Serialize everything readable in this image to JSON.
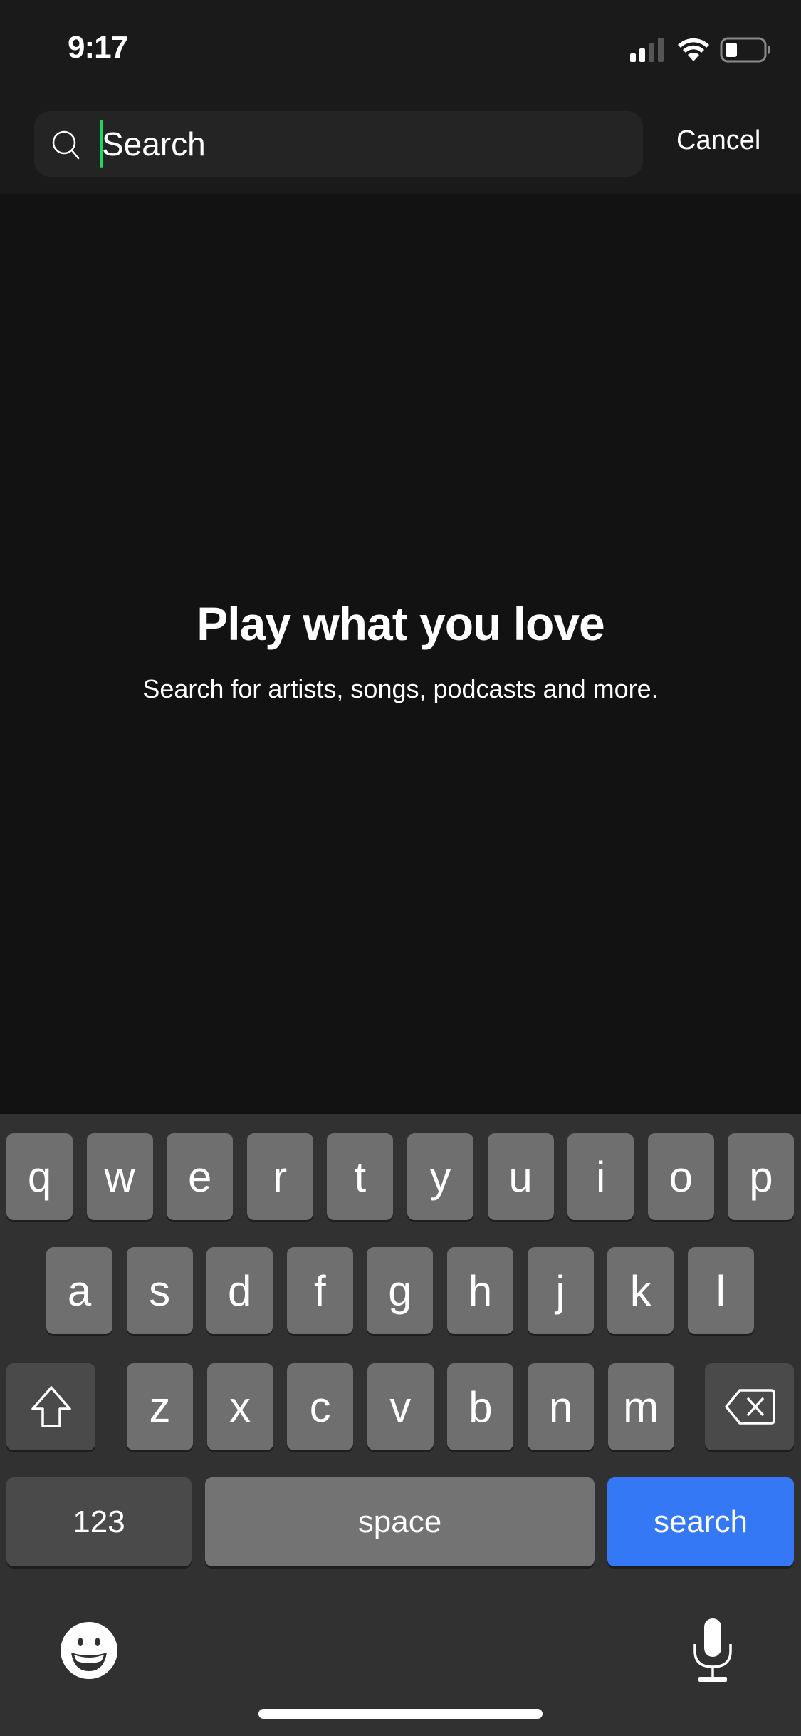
{
  "status_bar": {
    "time": "9:17",
    "icons": [
      "cellular-signal-icon",
      "wifi-icon",
      "battery-icon"
    ]
  },
  "search": {
    "placeholder": "Search",
    "value": "",
    "icon": "search-icon",
    "caret_color": "#1ed760",
    "cancel_label": "Cancel"
  },
  "empty_state": {
    "title": "Play what you love",
    "subtitle": "Search for artists, songs, podcasts and more."
  },
  "keyboard": {
    "row1": [
      "q",
      "w",
      "e",
      "r",
      "t",
      "y",
      "u",
      "i",
      "o",
      "p"
    ],
    "row2": [
      "a",
      "s",
      "d",
      "f",
      "g",
      "h",
      "j",
      "k",
      "l"
    ],
    "row3": [
      "z",
      "x",
      "c",
      "v",
      "b",
      "n",
      "m"
    ],
    "shift_icon": "shift-icon",
    "delete_icon": "delete-icon",
    "numbers_label": "123",
    "space_label": "space",
    "return_label": "search",
    "return_color": "#3478f6",
    "emoji_icon": "emoji-icon",
    "mic_icon": "microphone-icon"
  },
  "colors": {
    "header_bg": "#1a1a1a",
    "body_bg": "#121212",
    "keyboard_bg": "#313131",
    "key_bg": "#6f6f6f"
  }
}
